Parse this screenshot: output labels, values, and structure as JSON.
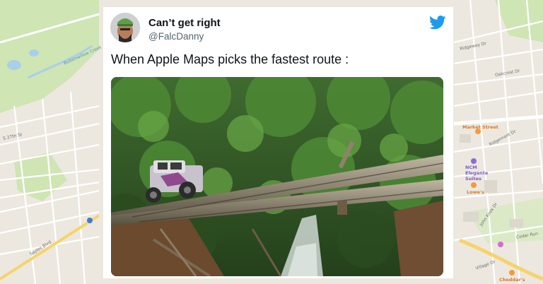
{
  "tweet": {
    "display_name": "Can’t get right",
    "handle": "@FalcDanny",
    "text": "When Apple Maps picks the fastest route :",
    "brand_icon": "twitter-bird-icon",
    "brand_color": "#1d9bf0",
    "photo": "off-road vehicle crossing log bridge in jungle"
  },
  "map": {
    "labels": {
      "s27th": "S 27th St",
      "sayles": "Sayles Blvd",
      "market": "Market Street",
      "ridgemont": "Ridgemont Dr",
      "ncm": "NCM Elegante Suites",
      "lowes": "Lowe's",
      "johnknox": "John Knox Dr",
      "cheddars": "Cheddar's",
      "creek": "Buttonwillow Creek",
      "ridgeway": "Ridgeway Dr",
      "oakcrest": "Oakcrest Dr",
      "cedarrun": "Cedar Run",
      "village": "Village Dr"
    },
    "colors": {
      "land": "#ece8df",
      "park": "#cfe5b4",
      "water": "#a9cfe9",
      "road": "#ffffff",
      "highway": "#f6d36b"
    }
  }
}
